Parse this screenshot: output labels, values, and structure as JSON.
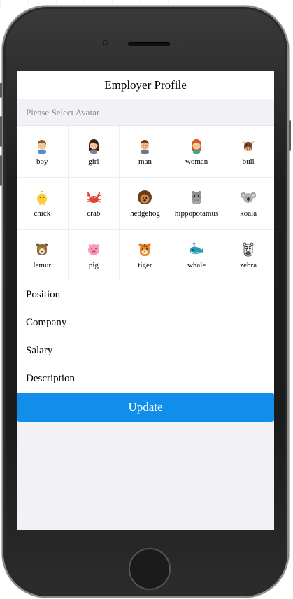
{
  "header": {
    "title": "Employer Profile"
  },
  "avatar_section": {
    "title": "Please Select Avatar",
    "avatars": [
      {
        "label": "boy",
        "icon": "boy-icon"
      },
      {
        "label": "girl",
        "icon": "girl-icon"
      },
      {
        "label": "man",
        "icon": "man-icon"
      },
      {
        "label": "woman",
        "icon": "woman-icon"
      },
      {
        "label": "bull",
        "icon": "bull-icon"
      },
      {
        "label": "chick",
        "icon": "chick-icon"
      },
      {
        "label": "crab",
        "icon": "crab-icon"
      },
      {
        "label": "hedgehog",
        "icon": "hedgehog-icon"
      },
      {
        "label": "hippopotamus",
        "icon": "hippopotamus-icon"
      },
      {
        "label": "koala",
        "icon": "koala-icon"
      },
      {
        "label": "lemur",
        "icon": "lemur-icon"
      },
      {
        "label": "pig",
        "icon": "pig-icon"
      },
      {
        "label": "tiger",
        "icon": "tiger-icon"
      },
      {
        "label": "whale",
        "icon": "whale-icon"
      },
      {
        "label": "zebra",
        "icon": "zebra-icon"
      }
    ]
  },
  "form": {
    "position_placeholder": "Position",
    "company_placeholder": "Company",
    "salary_placeholder": "Salary",
    "description_placeholder": "Description"
  },
  "actions": {
    "update_label": "Update"
  },
  "colors": {
    "primary": "#108ee9",
    "background": "#f2f1f6",
    "hint_text": "#888888"
  }
}
